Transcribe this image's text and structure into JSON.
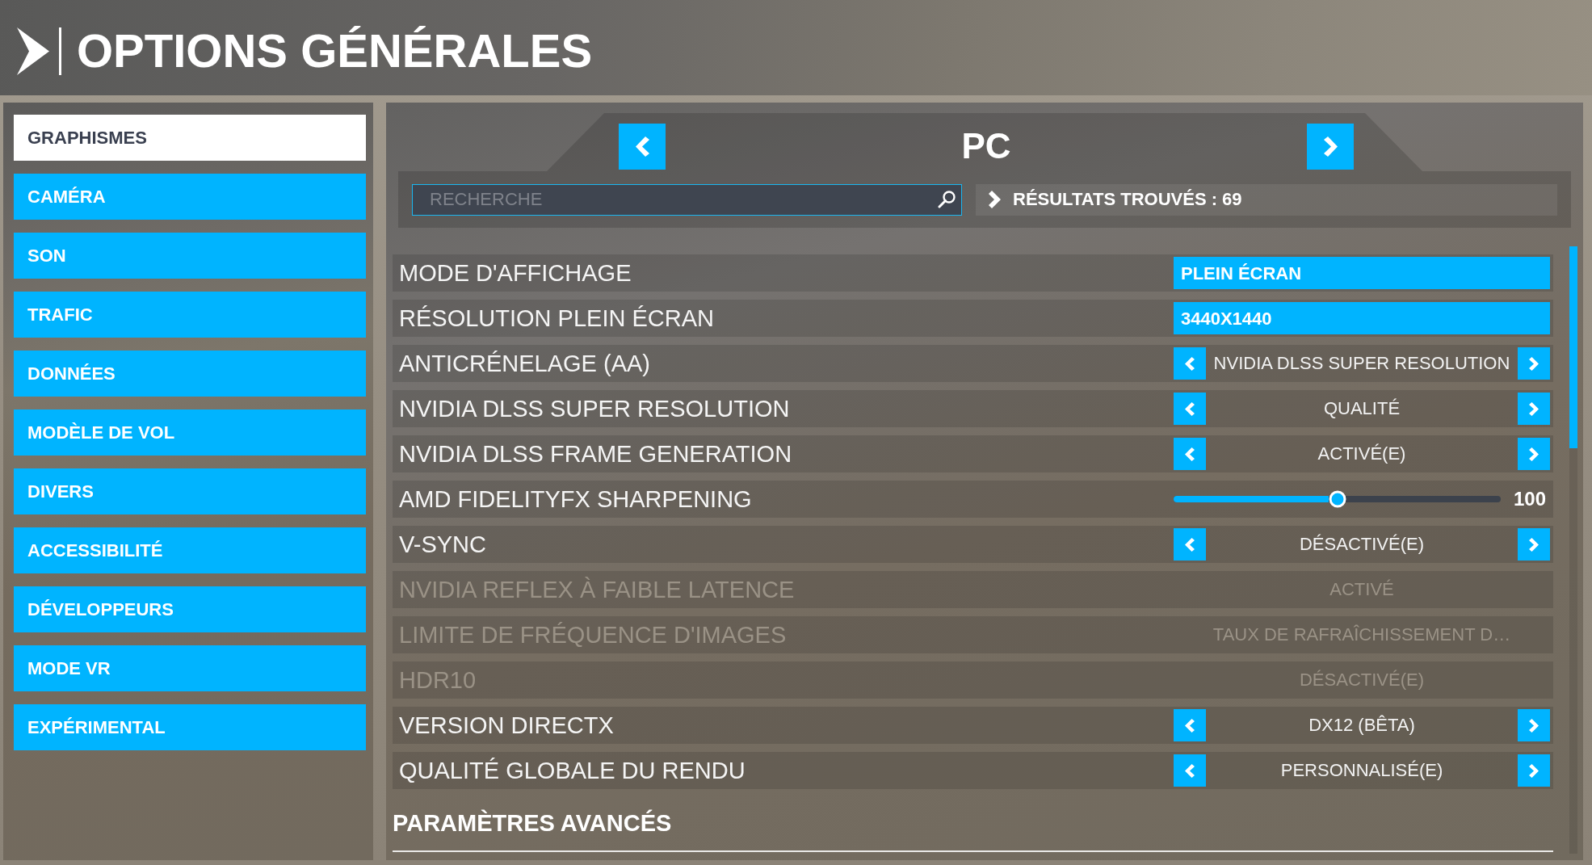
{
  "header": {
    "title": "OPTIONS GÉNÉRALES"
  },
  "sidebar": {
    "items": [
      {
        "label": "GRAPHISMES",
        "selected": true
      },
      {
        "label": "CAMÉRA",
        "selected": false
      },
      {
        "label": "SON",
        "selected": false
      },
      {
        "label": "TRAFIC",
        "selected": false
      },
      {
        "label": "DONNÉES",
        "selected": false
      },
      {
        "label": "MODÈLE DE VOL",
        "selected": false
      },
      {
        "label": "DIVERS",
        "selected": false
      },
      {
        "label": "ACCESSIBILITÉ",
        "selected": false
      },
      {
        "label": "DÉVELOPPEURS",
        "selected": false
      },
      {
        "label": "MODE VR",
        "selected": false
      },
      {
        "label": "EXPÉRIMENTAL",
        "selected": false
      }
    ]
  },
  "panel": {
    "title": "PC",
    "search": {
      "placeholder": "RECHERCHE"
    },
    "results": "RÉSULTATS TROUVÉS : 69",
    "settings": [
      {
        "kind": "dropdown",
        "label": "MODE D'AFFICHAGE",
        "value": "PLEIN ÉCRAN",
        "disabled": false
      },
      {
        "kind": "dropdown",
        "label": "RÉSOLUTION PLEIN ÉCRAN",
        "value": "3440X1440",
        "disabled": false
      },
      {
        "kind": "stepper",
        "label": "ANTICRÉNELAGE (AA)",
        "value": "NVIDIA DLSS SUPER RESOLUTION",
        "disabled": false
      },
      {
        "kind": "stepper",
        "label": "NVIDIA DLSS SUPER RESOLUTION",
        "value": "QUALITÉ",
        "disabled": false
      },
      {
        "kind": "stepper",
        "label": "NVIDIA DLSS FRAME GENERATION",
        "value": "ACTIVÉ(E)",
        "disabled": false
      },
      {
        "kind": "slider",
        "label": "AMD FIDELITYFX SHARPENING",
        "level": 0.5,
        "reading": "100",
        "disabled": false
      },
      {
        "kind": "stepper",
        "label": "V-SYNC",
        "value": "DÉSACTIVÉ(E)",
        "disabled": false
      },
      {
        "kind": "stepper",
        "label": "NVIDIA REFLEX À FAIBLE LATENCE",
        "value": "ACTIVÉ",
        "disabled": true
      },
      {
        "kind": "stepper",
        "label": "LIMITE DE FRÉQUENCE D'IMAGES",
        "value": "TAUX DE RAFRAÎCHISSEMENT D…",
        "disabled": true
      },
      {
        "kind": "stepper",
        "label": "HDR10",
        "value": "DÉSACTIVÉ(E)",
        "disabled": true
      },
      {
        "kind": "stepper",
        "label": "VERSION DIRECTX",
        "value": "DX12 (BÊTA)",
        "disabled": false
      },
      {
        "kind": "stepper",
        "label": "QUALITÉ GLOBALE DU RENDU",
        "value": "PERSONNALISÉ(E)",
        "disabled": false
      }
    ],
    "section_heading": "PARAMÈTRES AVANCÉS"
  }
}
